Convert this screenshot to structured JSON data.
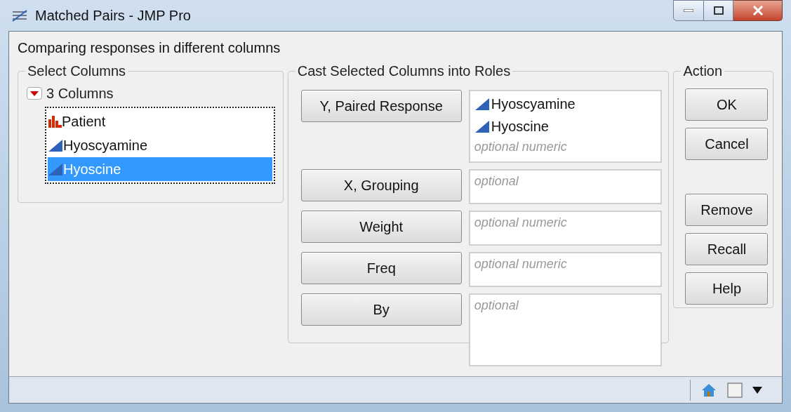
{
  "window": {
    "title": "Matched Pairs - JMP Pro"
  },
  "description": "Comparing responses in different columns",
  "select_columns": {
    "title": "Select Columns",
    "count_label": "3 Columns",
    "columns": [
      {
        "label": "Patient",
        "kind": "nominal",
        "selected": false
      },
      {
        "label": "Hyoscyamine",
        "kind": "continuous",
        "selected": false
      },
      {
        "label": "Hyoscine",
        "kind": "continuous",
        "selected": true
      }
    ]
  },
  "roles": {
    "title": "Cast Selected Columns into Roles",
    "rows": [
      {
        "button": "Y, Paired Response",
        "items": [
          {
            "label": "Hyoscyamine",
            "kind": "continuous"
          },
          {
            "label": "Hyoscine",
            "kind": "continuous"
          }
        ],
        "placeholder": "optional numeric"
      },
      {
        "button": "X, Grouping",
        "placeholder": "optional"
      },
      {
        "button": "Weight",
        "placeholder": "optional numeric"
      },
      {
        "button": "Freq",
        "placeholder": "optional numeric"
      },
      {
        "button": "By",
        "placeholder": "optional"
      }
    ]
  },
  "action": {
    "title": "Action",
    "buttons": [
      "OK",
      "Cancel"
    ],
    "buttons_lower": [
      "Remove",
      "Recall",
      "Help"
    ]
  }
}
